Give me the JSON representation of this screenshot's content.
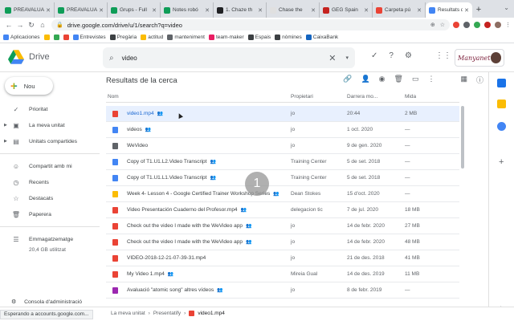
{
  "browser": {
    "tabs": [
      {
        "label": "PREAVALUA",
        "color": "#0f9d58"
      },
      {
        "label": "PREAVALUA",
        "color": "#0f9d58"
      },
      {
        "label": "Grups - Full",
        "color": "#0f9d58"
      },
      {
        "label": "Notes robó",
        "color": "#0f9d58"
      },
      {
        "label": "1. Chaze th",
        "color": "#202124"
      },
      {
        "label": "Chase the",
        "color": "#e0e0e0"
      },
      {
        "label": "GEG Spain",
        "color": "#c5221f"
      },
      {
        "label": "Carpeta pú",
        "color": "#ea4335"
      },
      {
        "label": "Resultats d",
        "color": "#4285f4",
        "active": true
      }
    ],
    "url": "drive.google.com/drive/u/1/search?q=video",
    "bookmarks": [
      {
        "label": "Aplicaciones",
        "color": "#4285f4"
      },
      {
        "label": "",
        "color": "#fbbc04"
      },
      {
        "label": "",
        "color": "#34a853"
      },
      {
        "label": "",
        "color": "#ea4335"
      },
      {
        "label": "Entrevistes",
        "color": "#4285f4"
      },
      {
        "label": "Pregària",
        "color": "#3c4043"
      },
      {
        "label": "actitud",
        "color": "#fbbc04"
      },
      {
        "label": "manteniment",
        "color": "#5f6368"
      },
      {
        "label": "team-maker",
        "color": "#e91e63"
      },
      {
        "label": "Espais",
        "color": "#3c4043"
      },
      {
        "label": "nòmines",
        "color": "#3c4043"
      },
      {
        "label": "CaixaBank",
        "color": "#1565c0"
      }
    ]
  },
  "drive": {
    "app_name": "Drive",
    "search_value": "video",
    "new_label": "Nou",
    "nav": [
      {
        "label": "Prioritat",
        "icon": "check-circle-icon",
        "glyph": "✓"
      },
      {
        "label": "La meva unitat",
        "icon": "drive-icon",
        "glyph": "▣",
        "caret": true
      },
      {
        "label": "Unitats compartides",
        "icon": "shared-drives-icon",
        "glyph": "▤",
        "caret": true
      },
      {
        "label": "Compartit amb mi",
        "icon": "people-icon",
        "glyph": "☺",
        "sep": true
      },
      {
        "label": "Recents",
        "icon": "clock-icon",
        "glyph": "◷"
      },
      {
        "label": "Destacats",
        "icon": "star-icon",
        "glyph": "☆"
      },
      {
        "label": "Paperera",
        "icon": "trash-icon",
        "glyph": "🗑"
      },
      {
        "label": "Emmagatzematge",
        "icon": "storage-icon",
        "glyph": "☰",
        "sep": true
      }
    ],
    "storage_used": "20,4 GB utilitzat",
    "admin_label": "Consola d'administració",
    "results_title": "Resultats de la cerca",
    "columns": {
      "name": "Nom",
      "owner": "Propietari",
      "modified": "Darrera mo...",
      "size": "Mida"
    },
    "files": [
      {
        "name": "video1.mp4",
        "shared": true,
        "owner": "jo",
        "modified": "20:44",
        "size": "2 MB",
        "color": "#ea4335",
        "selected": true
      },
      {
        "name": "videos",
        "shared": true,
        "owner": "jo",
        "modified": "1 oct. 2020",
        "size": "—",
        "color": "#4285f4"
      },
      {
        "name": "WeVideo",
        "shared": false,
        "owner": "jo",
        "modified": "9 de gen. 2020",
        "size": "—",
        "color": "#5f6368"
      },
      {
        "name": "Copy of T1.U1.L2.Video Transcript",
        "shared": true,
        "owner": "Training Center",
        "modified": "5 de set. 2018",
        "size": "—",
        "color": "#4285f4"
      },
      {
        "name": "Copy of T1.U1.L1.Video Transcript",
        "shared": true,
        "owner": "Training Center",
        "modified": "5 de set. 2018",
        "size": "—",
        "color": "#4285f4"
      },
      {
        "name": "Week 4- Lesson 4 - Google Certified Trainer Workshop Series",
        "shared": true,
        "owner": "Dean Stokes",
        "modified": "15 d'oct. 2020",
        "size": "—",
        "color": "#fbbc04"
      },
      {
        "name": "Video Presentación Cuaderno del Profesor.mp4",
        "shared": true,
        "owner": "delegacion tic",
        "modified": "7 de jul. 2020",
        "size": "18 MB",
        "color": "#ea4335"
      },
      {
        "name": "Check out the video I made with the WeVideo app",
        "shared": true,
        "owner": "jo",
        "modified": "14 de febr. 2020",
        "size": "27 MB",
        "color": "#ea4335"
      },
      {
        "name": "Check out the video I made with the WeVideo app",
        "shared": true,
        "owner": "jo",
        "modified": "14 de febr. 2020",
        "size": "48 MB",
        "color": "#ea4335"
      },
      {
        "name": "VIDEO-2018-12-21-07-39-31.mp4",
        "shared": false,
        "owner": "jo",
        "modified": "21 de des. 2018",
        "size": "41 MB",
        "color": "#ea4335"
      },
      {
        "name": "My Video 1.mp4",
        "shared": true,
        "owner": "Mireia Gual",
        "modified": "14 de des. 2019",
        "size": "11 MB",
        "color": "#ea4335"
      },
      {
        "name": "Avaluació \"atomic song\" altres vídeos",
        "shared": true,
        "owner": "jo",
        "modified": "8 de febr. 2019",
        "size": "—",
        "color": "#9c27b0"
      }
    ],
    "shared_glyph": "👥",
    "click_marker": "1",
    "status_text": "Esperando a accounts.google.com...",
    "breadcrumb": [
      "La meva unitat",
      "Presentatify",
      "video1.mp4"
    ]
  }
}
